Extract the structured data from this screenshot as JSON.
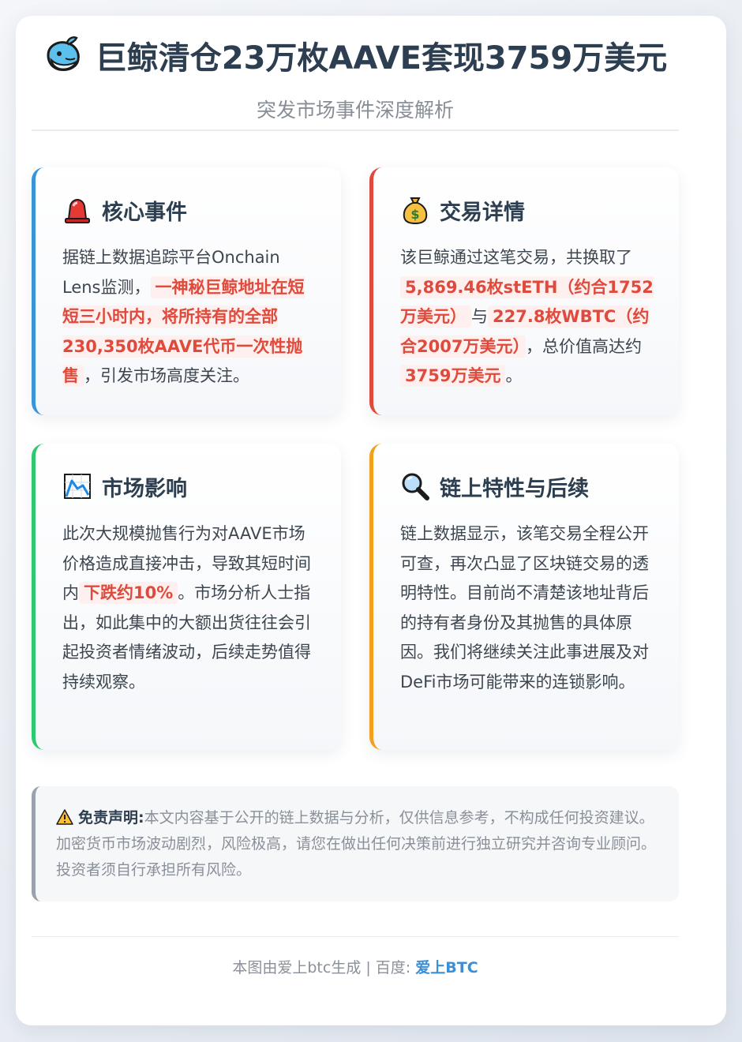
{
  "header": {
    "title": "巨鲸清仓23万枚AAVE套现3759万美元",
    "subtitle": "突发市场事件深度解析",
    "title_icon": "whale-icon"
  },
  "sections": {
    "core": {
      "title": "核心事件",
      "icon": "siren-icon",
      "accent": "#3a95d8",
      "text_1": "据链上数据追踪平台Onchain Lens监测，",
      "highlight_1": "一神秘巨鲸地址在短短三小时内，将所持有的全部230,350枚AAVE代币一次性抛售",
      "text_2": "，引发市场高度关注。"
    },
    "trade": {
      "title": "交易详情",
      "icon": "money-bag-icon",
      "accent": "#e04a3c",
      "text_1": "该巨鲸通过这笔交易，共换取了",
      "highlight_1": "5,869.46枚stETH（约合1752万美元）",
      "text_2": "与",
      "highlight_2": "227.8枚WBTC（约合2007万美元）",
      "text_3": "，总价值高达约",
      "highlight_3": "3759万美元",
      "text_4": "。"
    },
    "impact": {
      "title": "市场影响",
      "icon": "chart-down-icon",
      "accent": "#2ec871",
      "text_1": "此次大规模抛售行为对AAVE市场价格造成直接冲击，导致其短时间内",
      "highlight_1": "下跌约10%",
      "text_2": "。市场分析人士指出，如此集中的大额出货往往会引起投资者情绪波动，后续走势值得持续观察。"
    },
    "onchain": {
      "title": "链上特性与后续",
      "icon": "magnifier-icon",
      "accent": "#f1a020",
      "text_1": "链上数据显示，该笔交易全程公开可查，再次凸显了区块链交易的透明特性。目前尚不清楚该地址背后的持有者身份及其抛售的具体原因。我们将继续关注此事进展及对DeFi市场可能带来的连锁影响。"
    }
  },
  "disclaimer": {
    "label": "免责声明:",
    "text": "本文内容基于公开的链上数据与分析，仅供信息参考，不构成任何投资建议。加密货币市场波动剧烈，风险极高，请您在做出任何决策前进行独立研究并咨询专业顾问。投资者须自行承担所有风险。",
    "icon": "warning-icon"
  },
  "footer": {
    "prefix": "本图由爱上btc生成 | 百度: ",
    "brand": "爱上BTC"
  }
}
